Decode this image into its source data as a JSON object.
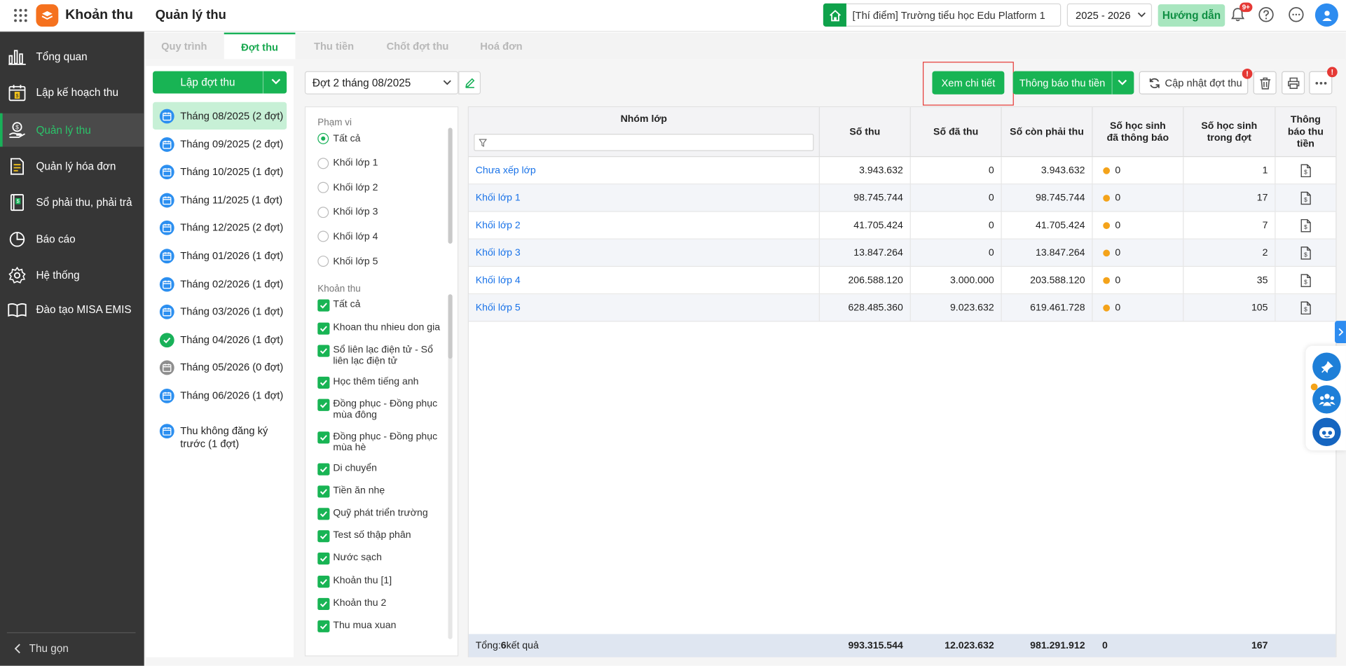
{
  "app": {
    "name": "Khoản thu",
    "page_title": "Quản lý thu",
    "notification_count": "9+"
  },
  "header": {
    "school": "[Thí điểm] Trường tiểu học Edu Platform 1",
    "year": "2025 - 2026",
    "guide_label": "Hướng dẫn"
  },
  "sidebar": {
    "items": [
      {
        "label": "Tổng quan",
        "icon": "chart-bars-icon"
      },
      {
        "label": "Lập kế hoạch thu",
        "icon": "calendar-money-icon"
      },
      {
        "label": "Quản lý thu",
        "icon": "hand-money-icon",
        "active": true
      },
      {
        "label": "Quản lý hóa đơn",
        "icon": "invoice-icon"
      },
      {
        "label": "Sổ phải thu, phải trả",
        "icon": "ledger-book-icon"
      },
      {
        "label": "Báo cáo",
        "icon": "pie-chart-icon"
      },
      {
        "label": "Hệ thống",
        "icon": "gear-icon"
      },
      {
        "label": "Đào tạo MISA EMIS",
        "icon": "open-book-icon"
      }
    ],
    "collapse_label": "Thu gọn"
  },
  "tabs": [
    "Quy trình",
    "Đợt thu",
    "Thu tiền",
    "Chốt đợt thu",
    "Hoá đơn"
  ],
  "left": {
    "create_label": "Lập đợt thu",
    "months": [
      {
        "label": "Tháng 08/2025 (2 đợt)",
        "status": "calendar",
        "active": true
      },
      {
        "label": "Tháng 09/2025 (2 đợt)",
        "status": "calendar"
      },
      {
        "label": "Tháng 10/2025 (1 đợt)",
        "status": "calendar"
      },
      {
        "label": "Tháng 11/2025 (1 đợt)",
        "status": "calendar"
      },
      {
        "label": "Tháng 12/2025 (2 đợt)",
        "status": "calendar"
      },
      {
        "label": "Tháng 01/2026 (1 đợt)",
        "status": "calendar"
      },
      {
        "label": "Tháng 02/2026 (1 đợt)",
        "status": "calendar"
      },
      {
        "label": "Tháng 03/2026 (1 đợt)",
        "status": "calendar"
      },
      {
        "label": "Tháng 04/2026 (1 đợt)",
        "status": "done"
      },
      {
        "label": "Tháng 05/2026 (0 đợt)",
        "status": "empty"
      },
      {
        "label": "Tháng 06/2026 (1 đợt)",
        "status": "calendar"
      },
      {
        "label": "Thu không đăng ký trước (1 đợt)",
        "status": "calendar"
      }
    ]
  },
  "period_select": "Đợt 2 tháng 08/2025",
  "filter": {
    "scope_title": "Phạm vi",
    "scope_options": [
      "Tất cả",
      "Khối lớp 1",
      "Khối lớp 2",
      "Khối lớp 3",
      "Khối lớp 4",
      "Khối lớp 5"
    ],
    "fee_title": "Khoản thu",
    "fees": [
      "Tất cả",
      "Khoan thu nhieu don gia",
      "Sổ liên lạc điện tử - Sổ liên lạc điện tử",
      "Học thêm tiếng anh",
      "Đồng phục - Đồng phục mùa đông",
      "Đồng phục - Đồng phục mùa hè",
      "Di chuyển",
      "Tiền ăn nhẹ",
      "Quỹ phát triển trường",
      "Test số thập phân",
      "Nước sạch",
      "Khoản thu [1]",
      "Khoản thu 2",
      "Thu mua xuan"
    ]
  },
  "toolbar": {
    "view_detail": "Xem chi tiết",
    "notify": "Thông báo thu tiền",
    "update": "Cập nhật đợt thu"
  },
  "table": {
    "headers": [
      "Nhóm lớp",
      "Số thu",
      "Số đã thu",
      "Số còn phải thu",
      "Số học sinh đã thông báo",
      "Số học sinh trong đợt",
      "Thông báo thu tiền"
    ],
    "rows": [
      {
        "group": "Chưa xếp lớp",
        "total": "3.943.632",
        "paid": "0",
        "remaining": "3.943.632",
        "notified": "0",
        "students": "1"
      },
      {
        "group": "Khối lớp 1",
        "total": "98.745.744",
        "paid": "0",
        "remaining": "98.745.744",
        "notified": "0",
        "students": "17"
      },
      {
        "group": "Khối lớp 2",
        "total": "41.705.424",
        "paid": "0",
        "remaining": "41.705.424",
        "notified": "0",
        "students": "7"
      },
      {
        "group": "Khối lớp 3",
        "total": "13.847.264",
        "paid": "0",
        "remaining": "13.847.264",
        "notified": "0",
        "students": "2"
      },
      {
        "group": "Khối lớp 4",
        "total": "206.588.120",
        "paid": "3.000.000",
        "remaining": "203.588.120",
        "notified": "0",
        "students": "35"
      },
      {
        "group": "Khối lớp 5",
        "total": "628.485.360",
        "paid": "9.023.632",
        "remaining": "619.461.728",
        "notified": "0",
        "students": "105"
      }
    ],
    "footer": {
      "prefix": "Tổng: ",
      "count": "6",
      "suffix": " kết quả",
      "total": "993.315.544",
      "paid": "12.023.632",
      "remaining": "981.291.912",
      "notified": "0",
      "students": "167"
    }
  },
  "colors": {
    "primary": "#18b454",
    "link": "#1a73e8",
    "sidebar": "#363636",
    "accent_blue": "#2d8cf0",
    "alert": "#e53935"
  }
}
